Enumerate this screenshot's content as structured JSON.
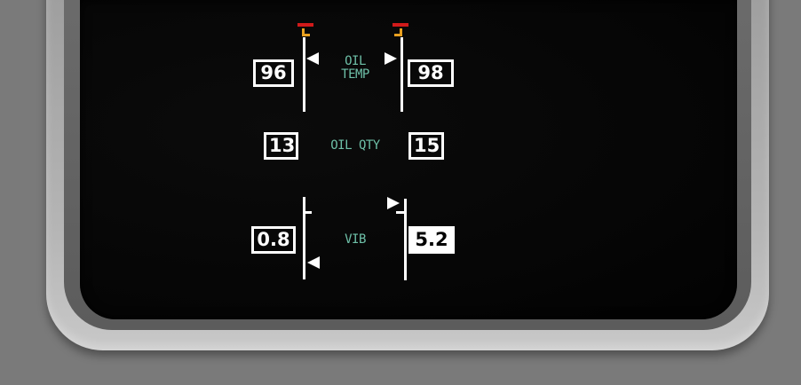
{
  "colors": {
    "bezel": "#7a7a7a",
    "screen": "#050505",
    "label": "#6ec0a8",
    "readout": "#ffffff",
    "redline": "#d11a1a",
    "amber": "#e8a020"
  },
  "oil_temp": {
    "label_line1": "OIL",
    "label_line2": "TEMP",
    "left_value": "96",
    "right_value": "98"
  },
  "oil_qty": {
    "label": "OIL QTY",
    "left_value": "13",
    "right_value": "15"
  },
  "vib": {
    "label": "VIB",
    "left_value": "0.8",
    "right_value": "5.2"
  }
}
